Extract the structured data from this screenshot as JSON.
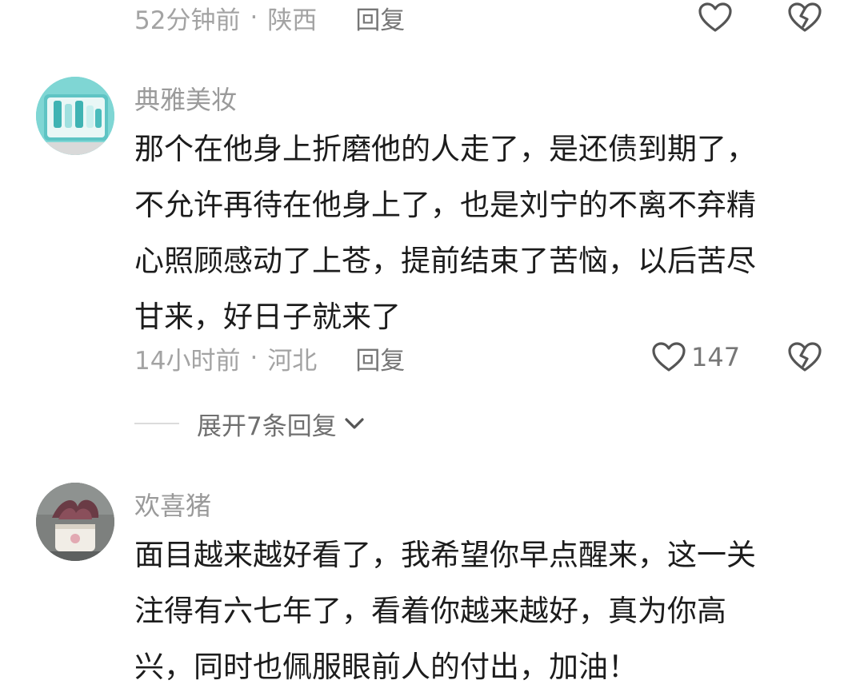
{
  "comments": [
    {
      "meta": {
        "time": "52分钟前",
        "separator": "·",
        "location": "陕西",
        "reply_label": "回复"
      }
    },
    {
      "username": "典雅美妆",
      "text_lines": [
        "那个在他身上折磨他的人走了，是还债到期了，",
        "不允许再待在他身上了，也是刘宁的不离不弃精",
        "心照顾感动了上苍，提前结束了苦恼，以后苦尽",
        "甘来，好日子就来了"
      ],
      "meta": {
        "time": "14小时前",
        "separator": "·",
        "location": "河北",
        "reply_label": "回复"
      },
      "like_count": "147",
      "expand_replies": "展开7条回复"
    },
    {
      "username": "欢喜猪",
      "text_lines": [
        "面目越来越好看了，我希望你早点醒来，这一关",
        "注得有六七年了，看着你越来越好，真为你高",
        "兴，同时也佩服眼前人的付出，加油！"
      ]
    }
  ],
  "icons": {
    "like": "heart-outline-icon",
    "dislike": "broken-heart-icon",
    "expand": "chevron-down-icon"
  },
  "colors": {
    "meta_text": "#a3a3a3",
    "body_text": "#1c1c1c",
    "icon_stroke": "#555555"
  }
}
